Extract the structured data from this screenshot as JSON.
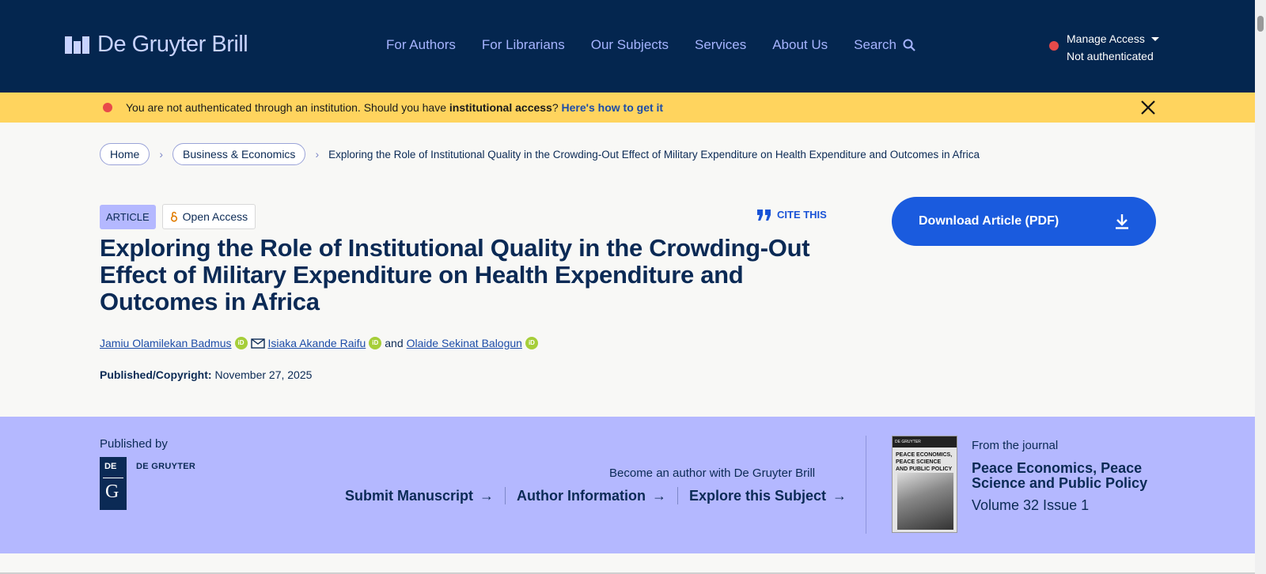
{
  "header": {
    "logo_text": "De Gruyter Brill",
    "nav": [
      "For Authors",
      "For Librarians",
      "Our Subjects",
      "Services",
      "About Us",
      "Search"
    ],
    "access_label": "Manage Access",
    "access_status": "Not authenticated"
  },
  "banner": {
    "text_prefix": "You are not authenticated through an institution. Should you have ",
    "text_bold": "institutional access",
    "text_q": "? ",
    "link": "Here's how to get it"
  },
  "breadcrumb": {
    "home": "Home",
    "category": "Business & Economics",
    "current": "Exploring the Role of Institutional Quality in the Crowding-Out Effect of Military Expenditure on Health Expenditure and Outcomes in Africa"
  },
  "article": {
    "type_tag": "ARTICLE",
    "open_access": "Open Access",
    "cite_label": "CITE THIS",
    "title": "Exploring the Role of Institutional Quality in the Crowding-Out Effect of Military Expenditure on Health Expenditure and Outcomes in Africa",
    "authors": [
      "Jamiu Olamilekan Badmus",
      "Isiaka Akande Raifu",
      "Olaide Sekinat Balogun"
    ],
    "and": "and",
    "published_label": "Published/Copyright:",
    "published_date": "November 27, 2025",
    "download_label": "Download Article (PDF)"
  },
  "publisher": {
    "label": "Published by",
    "logo_de": "DE",
    "logo_g": "G",
    "name": "DE GRUYTER"
  },
  "author_links": {
    "heading": "Become an author with De Gruyter Brill",
    "links": [
      "Submit Manuscript",
      "Author Information",
      "Explore this Subject"
    ]
  },
  "journal": {
    "from_label": "From the journal",
    "name": "Peace Economics, Peace Science and Public Policy",
    "volume": "Volume 32 Issue 1",
    "cover_title": "PEACE ECONOMICS, PEACE SCIENCE AND PUBLIC POLICY",
    "cover_publisher": "DE GRUYTER"
  },
  "colors": {
    "header_bg": "#04264f",
    "banner_bg": "#ffd45e",
    "band_bg": "#b4b8ff",
    "primary_button": "#1a5bde"
  }
}
